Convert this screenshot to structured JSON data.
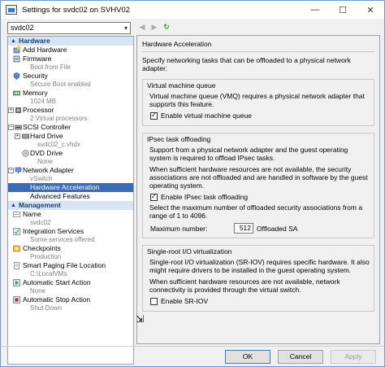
{
  "window": {
    "title": "Settings for svdc02 on SVHV02",
    "minimize_icon": "minimize-icon",
    "maximize_icon": "maximize-icon",
    "close_icon": "close-icon"
  },
  "vm_select": {
    "value": "svdc02"
  },
  "sidebar": {
    "hardware_header": "Hardware",
    "management_header": "Management",
    "hardware_items": [
      {
        "label": "Add Hardware",
        "sub": ""
      },
      {
        "label": "Firmware",
        "sub": "Boot from File"
      },
      {
        "label": "Security",
        "sub": "Secure Boot enabled"
      },
      {
        "label": "Memory",
        "sub": "1024 MB"
      },
      {
        "label": "Processor",
        "sub": "2 Virtual processors"
      },
      {
        "label": "SCSI Controller",
        "sub": ""
      },
      {
        "label": "Hard Drive",
        "sub": "svdc02_c.vhdx"
      },
      {
        "label": "DVD Drive",
        "sub": "None"
      },
      {
        "label": "Network Adapter",
        "sub": "vSwitch"
      },
      {
        "label": "Hardware Acceleration",
        "sub": ""
      },
      {
        "label": "Advanced Features",
        "sub": ""
      }
    ],
    "management_items": [
      {
        "label": "Name",
        "sub": "svdc02"
      },
      {
        "label": "Integration Services",
        "sub": "Some services offered"
      },
      {
        "label": "Checkpoints",
        "sub": "Production"
      },
      {
        "label": "Smart Paging File Location",
        "sub": "C:\\LocalVMs"
      },
      {
        "label": "Automatic Start Action",
        "sub": "None"
      },
      {
        "label": "Automatic Stop Action",
        "sub": "Shut Down"
      }
    ]
  },
  "panel": {
    "title": "Hardware Acceleration",
    "description": "Specify networking tasks that can be offloaded to a physical network adapter.",
    "vmq": {
      "title": "Virtual machine queue",
      "text": "Virtual machine queue (VMQ) requires a physical network adapter that supports this feature.",
      "checkbox": "Enable virtual machine queue"
    },
    "ipsec": {
      "title": "IPsec task offloading",
      "text1": "Support from a physical network adapter and the guest operating system is required to offload IPsec tasks.",
      "text2": "When sufficient hardware resources are not available, the security associations are not offloaded and are handled in software by the guest operating system.",
      "checkbox": "Enable IPsec task offloading",
      "text3": "Select the maximum number of offloaded security associations from a range of 1 to 4096.",
      "max_label": "Maximum number:",
      "max_value": "512",
      "max_unit": "Offloaded SA"
    },
    "sriov": {
      "title": "Single-root I/O virtualization",
      "text1": "Single-root I/O virtualization (SR-IOV) requires specific hardware. It also might require drivers to be installed in the guest operating system.",
      "text2": "When sufficient hardware resources are not available, network connectivity is provided through the virtual switch.",
      "checkbox": "Enable SR-IOV"
    }
  },
  "footer": {
    "ok": "OK",
    "cancel": "Cancel",
    "apply": "Apply"
  }
}
